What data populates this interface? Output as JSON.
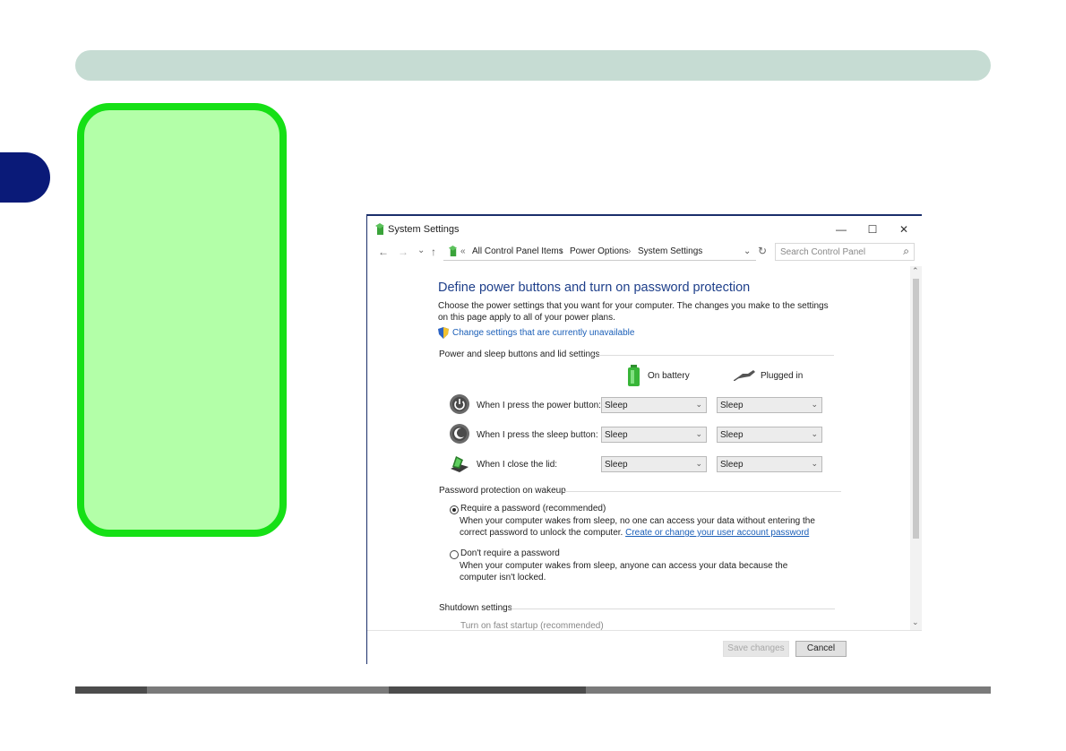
{
  "window": {
    "title": "System Settings",
    "controls": {
      "minimize": "—",
      "maximize": "☐",
      "close": "✕"
    }
  },
  "address_bar": {
    "back": "←",
    "forward": "→",
    "recent": "⌄",
    "up": "↑",
    "overflow": "«",
    "crumbs": [
      "All Control Panel Items",
      "Power Options",
      "System Settings"
    ],
    "separator": "›",
    "dropdown": "⌄",
    "refresh": "↻",
    "search_placeholder": "Search Control Panel",
    "search_icon": "⌕"
  },
  "page": {
    "heading": "Define power buttons and turn on password protection",
    "description": "Choose the power settings that you want for your computer. The changes you make to the settings on this page apply to all of your power plans.",
    "change_settings_link": "Change settings that are currently unavailable"
  },
  "power_buttons": {
    "section_title": "Power and sleep buttons and lid settings",
    "on_battery": "On battery",
    "plugged_in": "Plugged in",
    "rows": [
      {
        "label": "When I press the power button:",
        "battery": "Sleep",
        "plugged": "Sleep"
      },
      {
        "label": "When I press the sleep button:",
        "battery": "Sleep",
        "plugged": "Sleep"
      },
      {
        "label": "When I close the lid:",
        "battery": "Sleep",
        "plugged": "Sleep"
      }
    ]
  },
  "password": {
    "section_title": "Password protection on wakeup",
    "require_label": "Require a password (recommended)",
    "require_desc": "When your computer wakes from sleep, no one can access your data without entering the correct password to unlock the computer.",
    "account_link": "Create or change your user account password",
    "no_require_label": "Don't require a password",
    "no_require_desc": "When your computer wakes from sleep, anyone can access your data because the computer isn't locked."
  },
  "shutdown": {
    "section_title": "Shutdown settings",
    "fast_startup": "Turn on fast startup (recommended)"
  },
  "footer": {
    "save": "Save changes",
    "cancel": "Cancel"
  },
  "colors": {
    "header_bar": "#c6dcd3",
    "chapter_tab": "#0a1a78",
    "note_box_fill": "#b3ffa8",
    "note_box_border": "#16e016",
    "link": "#1b5fb8",
    "heading": "#1e3f8a"
  }
}
